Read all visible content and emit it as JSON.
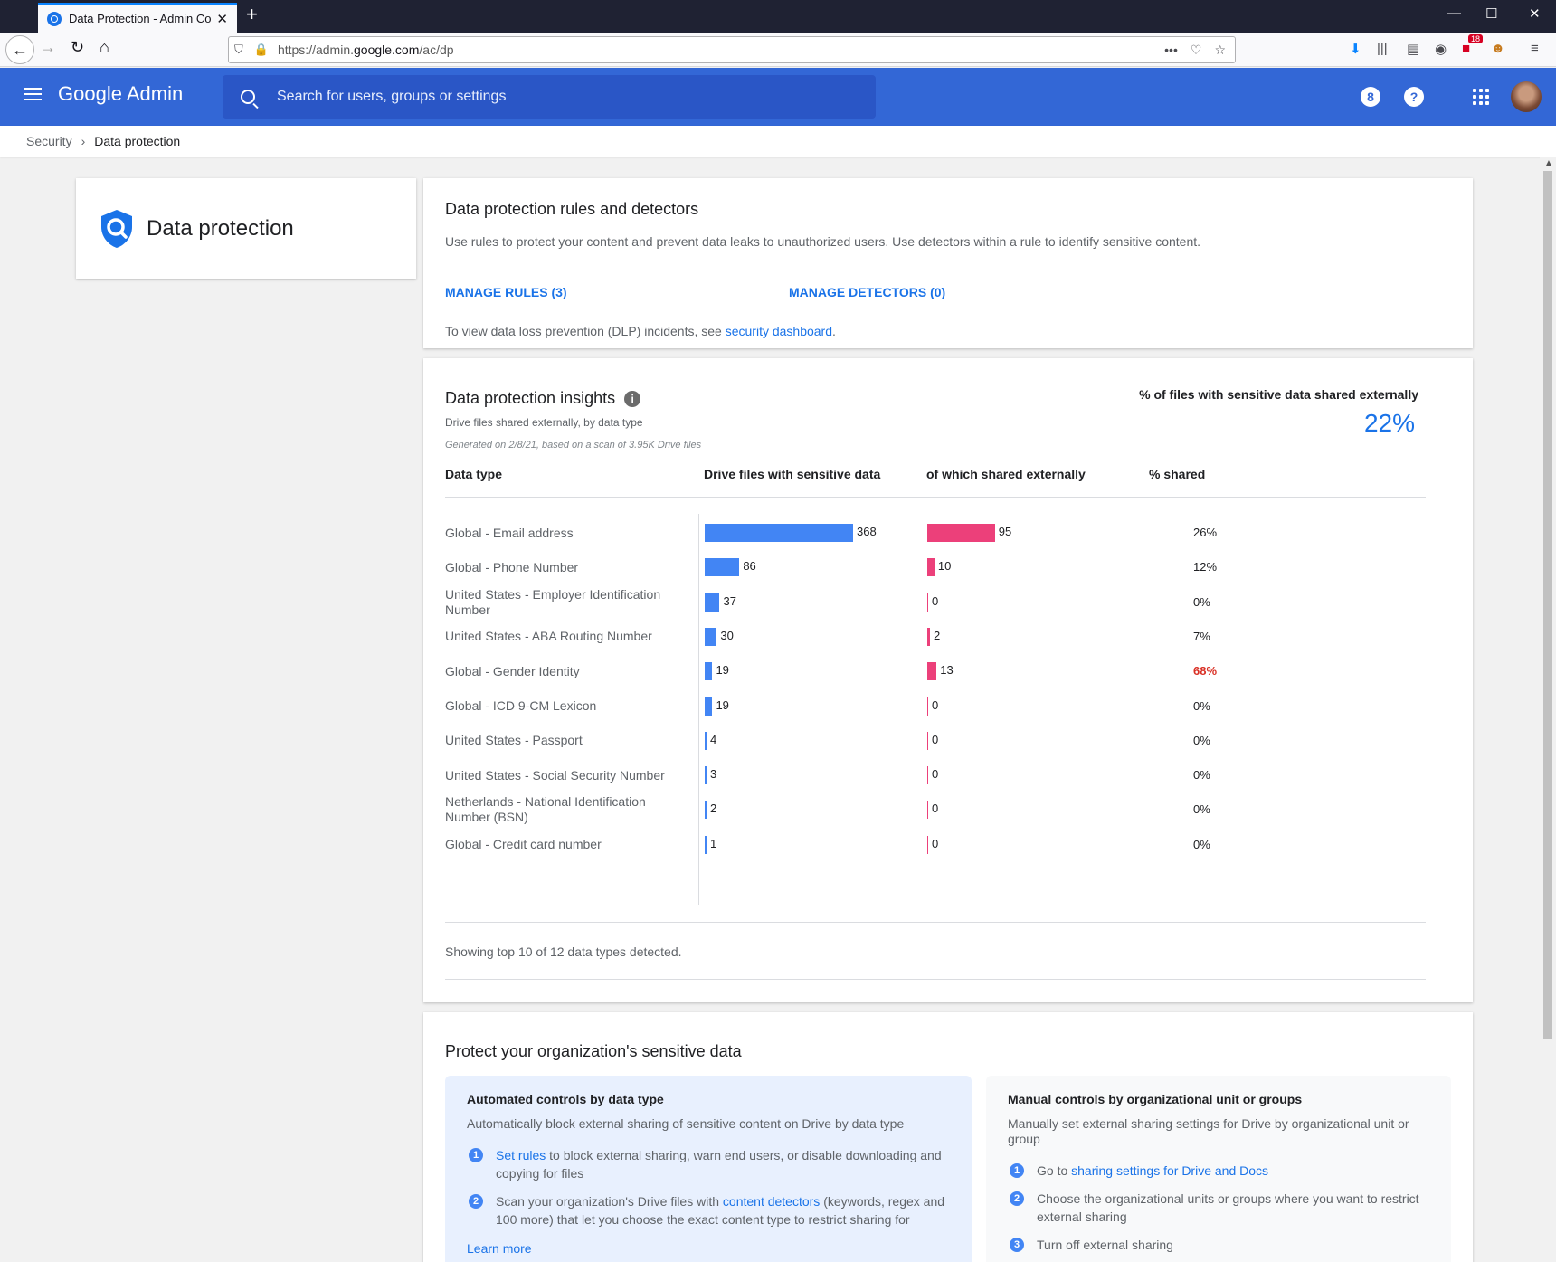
{
  "browser": {
    "tab_title": "Data Protection - Admin Console",
    "url_prefix": "https://admin.",
    "url_domain": "google.com",
    "url_path": "/ac/dp",
    "ext_badge": "18"
  },
  "header": {
    "logo": "Google Admin",
    "search_placeholder": "Search for users, groups or settings",
    "notif_count": "8",
    "help": "?"
  },
  "breadcrumb": {
    "parent": "Security",
    "current": "Data protection"
  },
  "sidebar": {
    "title": "Data protection"
  },
  "rules_card": {
    "title": "Data protection rules and detectors",
    "description": "Use rules to protect your content and prevent data leaks to unauthorized users. Use detectors within a rule to identify sensitive content.",
    "manage_rules": "MANAGE RULES (3)",
    "manage_detectors": "MANAGE DETECTORS (0)",
    "dlp_text": "To view data loss prevention (DLP) incidents, see ",
    "dlp_link": "security dashboard",
    "dlp_end": "."
  },
  "insights": {
    "title": "Data protection insights",
    "subtitle": "Drive files shared externally, by data type",
    "generated": "Generated on 2/8/21, based on a scan of 3.95K Drive files",
    "pct_label": "% of files with sensitive data shared externally",
    "pct_value": "22%",
    "columns": {
      "type": "Data type",
      "sensitive": "Drive files with sensitive data",
      "shared": "of which shared externally",
      "pct": "% shared"
    },
    "showing": "Showing top 10 of 12 data types detected."
  },
  "chart_data": {
    "type": "bar",
    "categories": [
      "Global - Email address",
      "Global - Phone Number",
      "United States - Employer Identification Number",
      "United States - ABA Routing Number",
      "Global - Gender Identity",
      "Global - ICD 9-CM Lexicon",
      "United States - Passport",
      "United States - Social Security Number",
      "Netherlands - National Identification Number (BSN)",
      "Global - Credit card number"
    ],
    "series": [
      {
        "name": "Drive files with sensitive data",
        "values": [
          368,
          86,
          37,
          30,
          19,
          19,
          4,
          3,
          2,
          1
        ],
        "color": "#4285f4"
      },
      {
        "name": "of which shared externally",
        "values": [
          95,
          10,
          0,
          2,
          13,
          0,
          0,
          0,
          0,
          0
        ],
        "color": "#ec407a"
      }
    ],
    "pct_shared": [
      "26%",
      "12%",
      "0%",
      "7%",
      "68%",
      "0%",
      "0%",
      "0%",
      "0%",
      "0%"
    ],
    "highlight_color": "#d93025"
  },
  "protect": {
    "title": "Protect your organization's sensitive data",
    "auto": {
      "title": "Automated controls by data type",
      "desc": "Automatically block external sharing of sensitive content on Drive by data type",
      "step1_link": "Set rules",
      "step1_text": " to block external sharing, warn end users, or disable downloading and copying for files",
      "step2_pre": "Scan your organization's Drive files with ",
      "step2_link": "content detectors",
      "step2_post": " (keywords, regex and 100 more) that let you choose the exact content type to restrict sharing for",
      "learn_more": "Learn more"
    },
    "manual": {
      "title": "Manual controls by organizational unit or groups",
      "desc": "Manually set external sharing settings for Drive by organizational unit or group",
      "step1_pre": "Go to ",
      "step1_link": "sharing settings for Drive and Docs",
      "step2": "Choose the organizational units or groups where you want to restrict external sharing",
      "step3": "Turn off external sharing"
    }
  }
}
